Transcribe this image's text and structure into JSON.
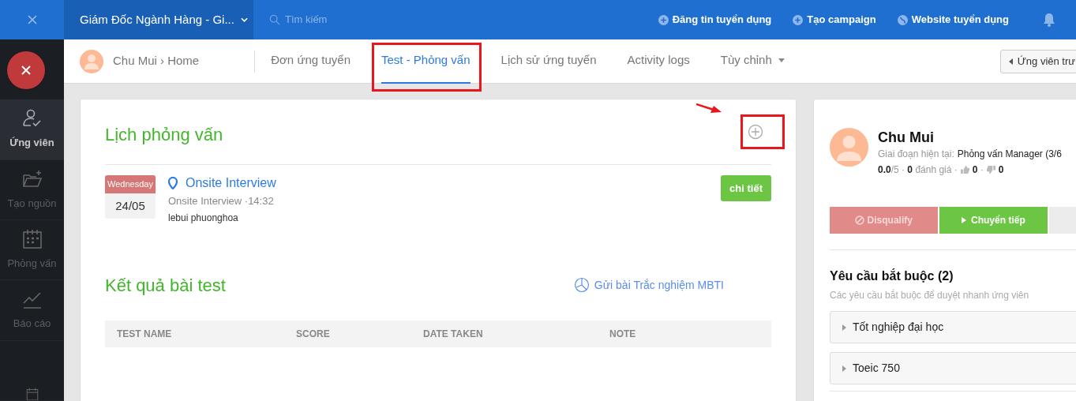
{
  "topbar": {
    "job_selector": "Giám Đốc Ngành Hàng - Gi...",
    "search": {
      "placeholder": "Tìm kiếm"
    },
    "actions": [
      {
        "label": "Đăng tin tuyển dụng",
        "kind": "plus"
      },
      {
        "label": "Tạo campaign",
        "kind": "plus"
      },
      {
        "label": "Website tuyển dụng",
        "kind": "globe"
      }
    ]
  },
  "sidebar": {
    "items": [
      {
        "label": "Ứng viên",
        "kind": "user-check",
        "selected": true
      },
      {
        "label": "Tạo nguồn",
        "kind": "folder",
        "selected": false
      },
      {
        "label": "Phỏng vấn",
        "kind": "calendar",
        "selected": false
      },
      {
        "label": "Báo cáo",
        "kind": "chart",
        "selected": false
      },
      {
        "kind": "calendar-check",
        "selected": false
      }
    ]
  },
  "header": {
    "breadcrumb": "Chu Mui › Home",
    "tabs": [
      {
        "label": "Đơn ứng tuyển",
        "selected": false,
        "kind": "plain",
        "annotated": false
      },
      {
        "label": "Test - Phỏng vấn",
        "selected": true,
        "kind": "plain",
        "annotated": true
      },
      {
        "label": "Lịch sử ứng tuyển",
        "selected": false,
        "kind": "plain",
        "annotated": false
      },
      {
        "label": "Activity logs",
        "selected": false,
        "kind": "plain",
        "annotated": false
      },
      {
        "label": "Tùy chỉnh",
        "selected": false,
        "kind": "dropdown",
        "annotated": false
      }
    ],
    "prev_button": "Ứng viên trư"
  },
  "interviews": {
    "title": "Lịch phỏng vấn",
    "add_annotated": true,
    "events": [
      {
        "day": "Wednesday",
        "date": "24/05",
        "title": "Onsite Interview",
        "subtitle": "Onsite Interview ·14:32",
        "people": "lebui phuonghoa",
        "action": "chi tiết"
      }
    ]
  },
  "tests": {
    "title": "Kết quả bài test",
    "mbti_link": "Gửi bài Trắc nghiệm MBTI",
    "columns": [
      "TEST NAME",
      "SCORE",
      "DATE TAKEN",
      "NOTE"
    ]
  },
  "profile": {
    "name": "Chu Mui",
    "stage_label": "Giai đoạn hiện tại:",
    "stage": "Phỏng vấn Manager (3/6",
    "rating": "**0.0**/5 · **0** đánh giá ·",
    "likes": "**0** ·",
    "dislikes": "**0**",
    "buttons": [
      {
        "label": "Disqualify",
        "kind": "disqualify"
      },
      {
        "label": "Chuyển tiếp",
        "kind": "forward"
      },
      {
        "kind": "more"
      }
    ],
    "requirements": {
      "title": "Yêu cầu bắt buộc (2)",
      "subtitle": "Các yêu cầu bắt buộc để duyệt nhanh ứng viên",
      "items": [
        {
          "label": "Tốt nghiệp đại học",
          "expanded": false
        },
        {
          "label": "Toeic 750",
          "expanded": false
        }
      ]
    }
  }
}
